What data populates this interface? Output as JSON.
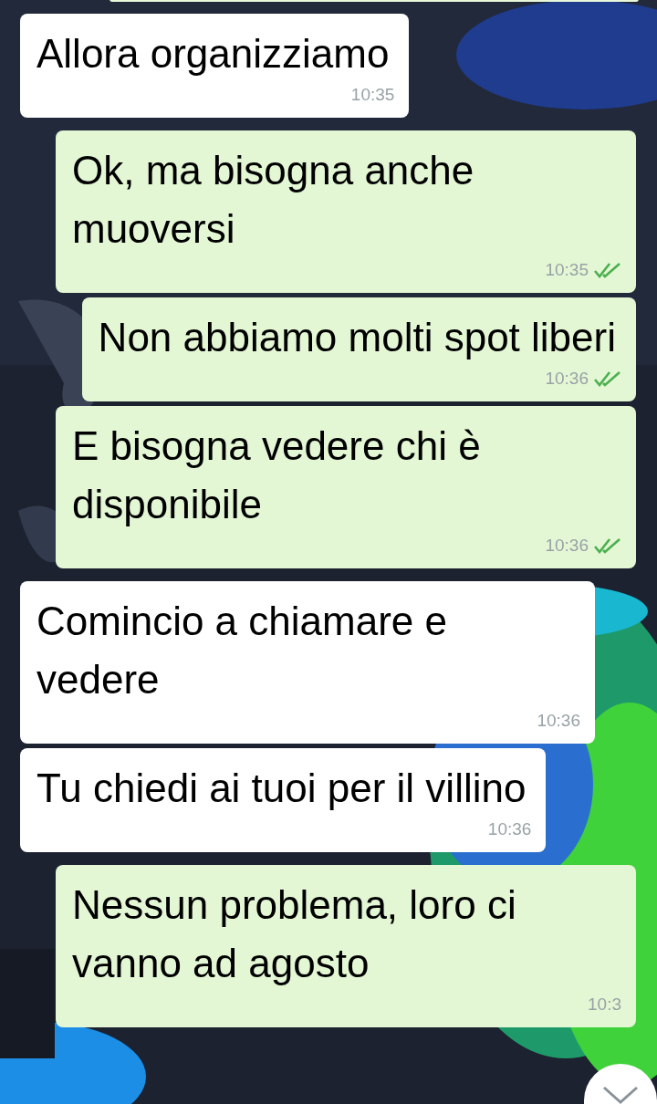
{
  "messages": [
    {
      "kind": "incoming",
      "text": "Allora organizziamo",
      "time": "10:35"
    },
    {
      "kind": "outgoing",
      "text": "Ok, ma bisogna anche muoversi",
      "time": "10:35",
      "read": true
    },
    {
      "kind": "outgoing",
      "text": "Non abbiamo molti spot liberi",
      "time": "10:36",
      "read": true
    },
    {
      "kind": "outgoing",
      "text": "E bisogna vedere chi è disponibile",
      "time": "10:36",
      "read": true
    },
    {
      "kind": "incoming",
      "text": "Comincio a chiamare e vedere",
      "time": "10:36"
    },
    {
      "kind": "incoming",
      "text": "Tu chiedi ai tuoi per il villino",
      "time": "10:36"
    },
    {
      "kind": "outgoing",
      "text": "Nessun problema, loro ci vanno ad agosto",
      "time": "10:3"
    }
  ]
}
